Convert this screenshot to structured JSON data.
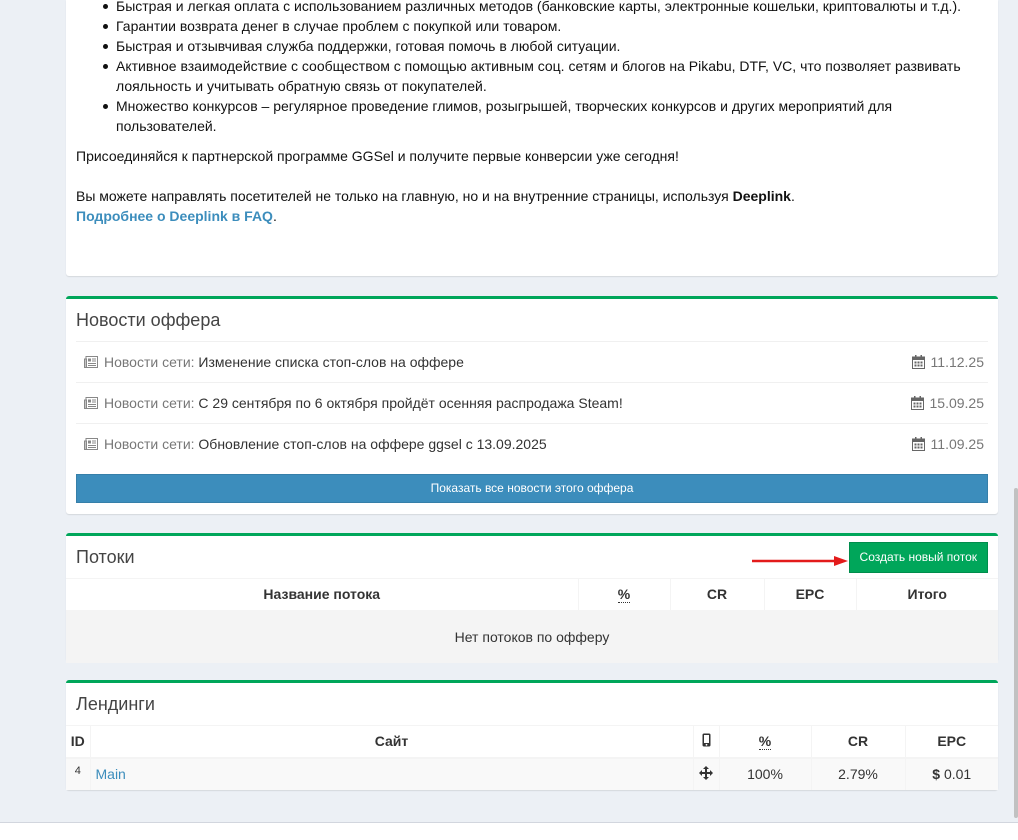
{
  "description": {
    "bullets": [
      "Быстрая и легкая оплата с использованием различных методов (банковские карты, электронные кошельки, криптовалюты и т.д.).",
      "Гарантии возврата денег в случае проблем с покупкой или товаром.",
      "Быстрая и отзывчивая служба поддержки, готовая помочь в любой ситуации.",
      "Активное взаимодействие с сообществом с помощью активным соц. сетям и блогов на Pikabu, DTF, VC, что позволяет развивать лояльность и учитывать обратную связь от покупателей.",
      "Множество конкурсов – регулярное проведение глимов, розыгрышей, творческих конкурсов и других мероприятий для пользователей."
    ],
    "join_text": "Присоединяйся к партнерской программе GGSel и получите первые конверсии уже сегодня!",
    "deeplink_text": "Вы можете направлять посетителей не только на главную, но и на внутренние страницы, используя ",
    "deeplink_bold": "Deeplink",
    "deeplink_end": ".",
    "faq_link": "Подробнее о Deeplink в FAQ",
    "faq_end": "."
  },
  "news": {
    "title": "Новости оффера",
    "items": [
      {
        "category": "Новости сети:",
        "title": "Изменение списка стоп-слов на оффере",
        "date": "11.12.25"
      },
      {
        "category": "Новости сети:",
        "title": "С 29 сентября по 6 октября пройдёт осенняя распродажа Steam!",
        "date": "15.09.25"
      },
      {
        "category": "Новости сети:",
        "title": "Обновление стоп-слов на оффере ggsel с 13.09.2025",
        "date": "11.09.25"
      }
    ],
    "show_all_label": "Показать все новости этого оффера"
  },
  "streams": {
    "title": "Потоки",
    "create_label": "Создать новый поток",
    "columns": [
      "Название потока",
      "%",
      "CR",
      "EPC",
      "Итого"
    ],
    "empty_text": "Нет потоков по офферу"
  },
  "landings": {
    "title": "Лендинги",
    "columns": {
      "id": "ID",
      "site": "Сайт",
      "percent": "%",
      "cr": "CR",
      "epc": "EPC"
    },
    "rows": [
      {
        "id": "4",
        "site": "Main",
        "percent": "100%",
        "cr": "2.79%",
        "epc_symbol": "$",
        "epc": "0.01"
      }
    ]
  },
  "colors": {
    "accent_green": "#00a65a",
    "button_blue": "#3c8dbc",
    "link": "#3c8dbc",
    "arrow": "#e31b1b"
  },
  "icons": {
    "news": "newspaper-icon",
    "date": "calendar-icon",
    "mobile": "mobile-icon",
    "move": "arrows-move-icon"
  }
}
